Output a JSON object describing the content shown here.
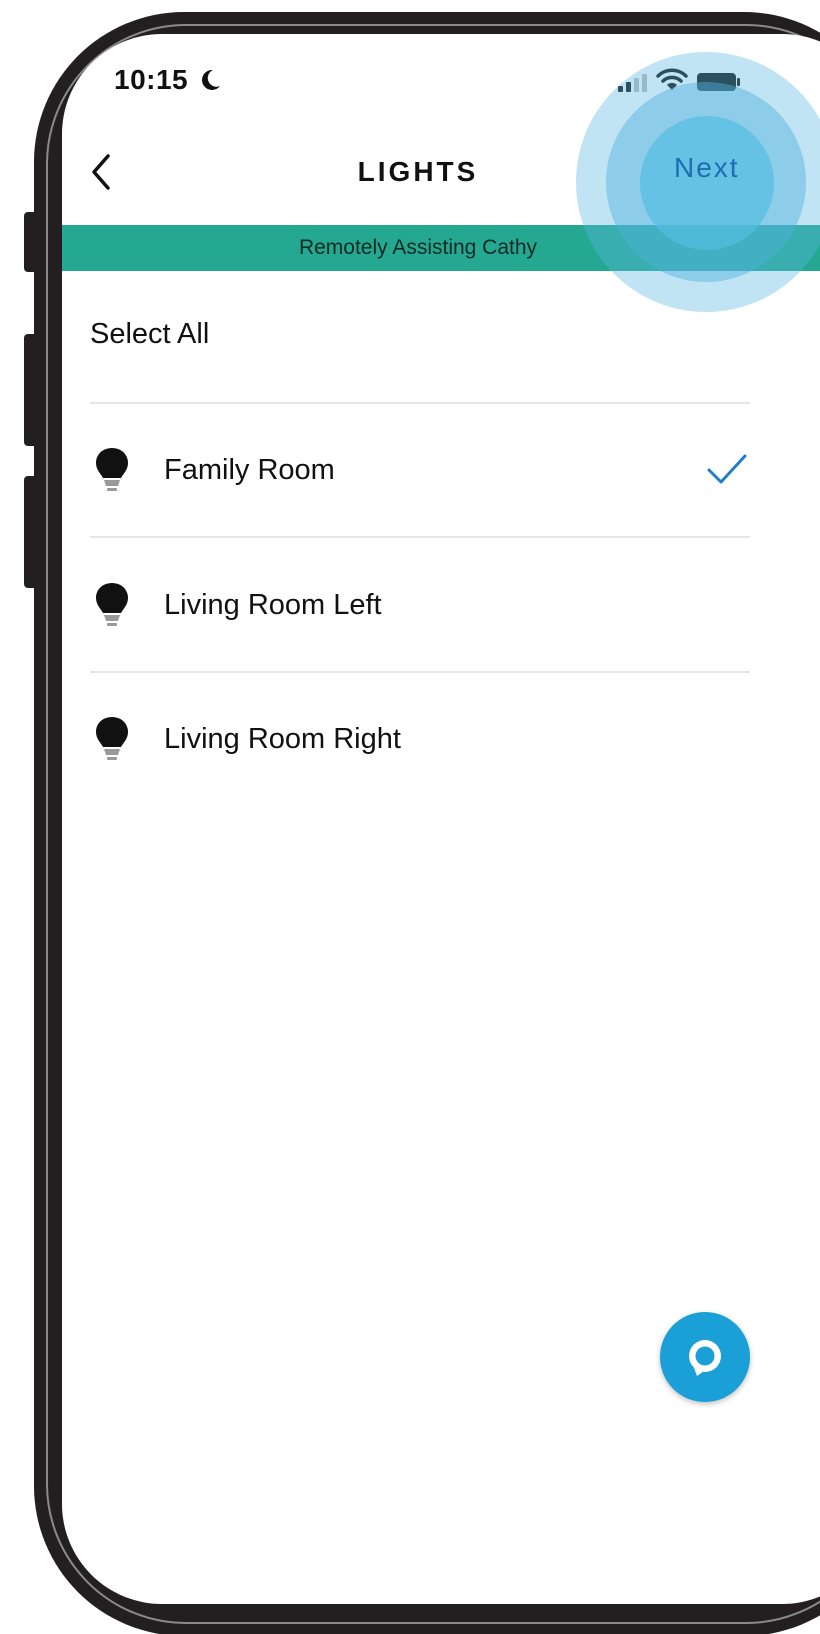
{
  "status_bar": {
    "time": "10:15",
    "icons": [
      "moon-icon",
      "signal-icon",
      "wifi-icon",
      "battery-icon"
    ]
  },
  "header": {
    "title": "LIGHTS",
    "next_label": "Next",
    "back_icon": "chevron-left-icon"
  },
  "banner": {
    "text": "Remotely Assisting Cathy"
  },
  "list": {
    "select_all_label": "Select All",
    "items": [
      {
        "label": "Family Room",
        "selected": true,
        "icon": "lightbulb-icon"
      },
      {
        "label": "Living Room Left",
        "selected": false,
        "icon": "lightbulb-icon"
      },
      {
        "label": "Living Room Right",
        "selected": false,
        "icon": "lightbulb-icon"
      }
    ]
  },
  "fab": {
    "icon": "alexa-icon"
  },
  "colors": {
    "banner": "#24a892",
    "accent_blue": "#1b6fb0",
    "check": "#1f7ec6",
    "alexa": "#1a9fd6",
    "frame": "#231f20"
  }
}
